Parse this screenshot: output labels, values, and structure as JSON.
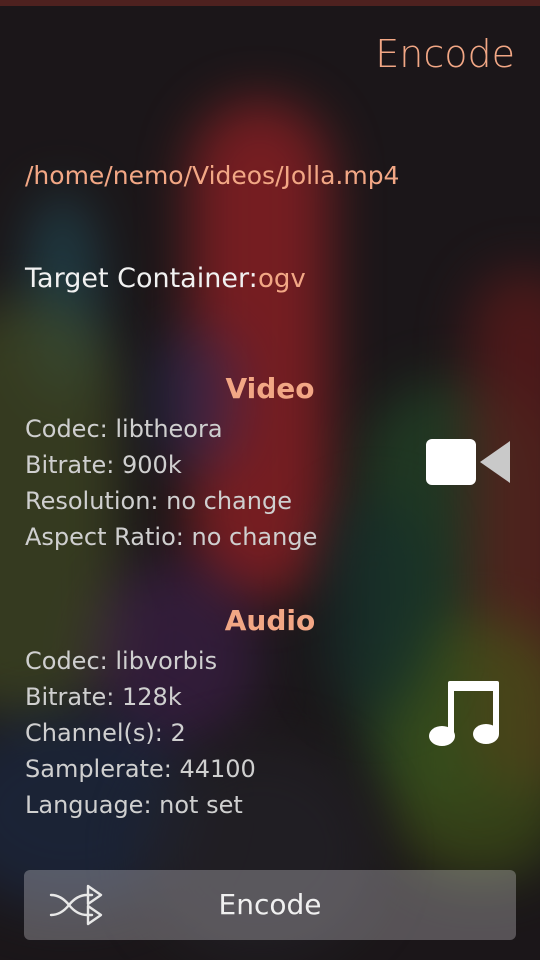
{
  "header": {
    "title": "Encode"
  },
  "file": {
    "path": "/home/nemo/Videos/Jolla.mp4"
  },
  "target": {
    "label": "Target Container:",
    "value": "ogv"
  },
  "video": {
    "title": "Video",
    "codec": "Codec: libtheora",
    "bitrate": "Bitrate: 900k",
    "resolution": "Resolution: no change",
    "aspect_ratio": "Aspect Ratio: no change",
    "icon": "video-camera-icon"
  },
  "audio": {
    "title": "Audio",
    "codec": "Codec: libvorbis",
    "bitrate": "Bitrate: 128k",
    "channels": "Channel(s): 2",
    "samplerate": "Samplerate: 44100",
    "language": "Language: not set",
    "icon": "music-note-icon"
  },
  "action": {
    "label": "Encode",
    "icon": "shuffle-icon"
  },
  "colors": {
    "accent": "#f2a785",
    "text": "#f1f1f1",
    "muted": "#cfcfcf"
  }
}
